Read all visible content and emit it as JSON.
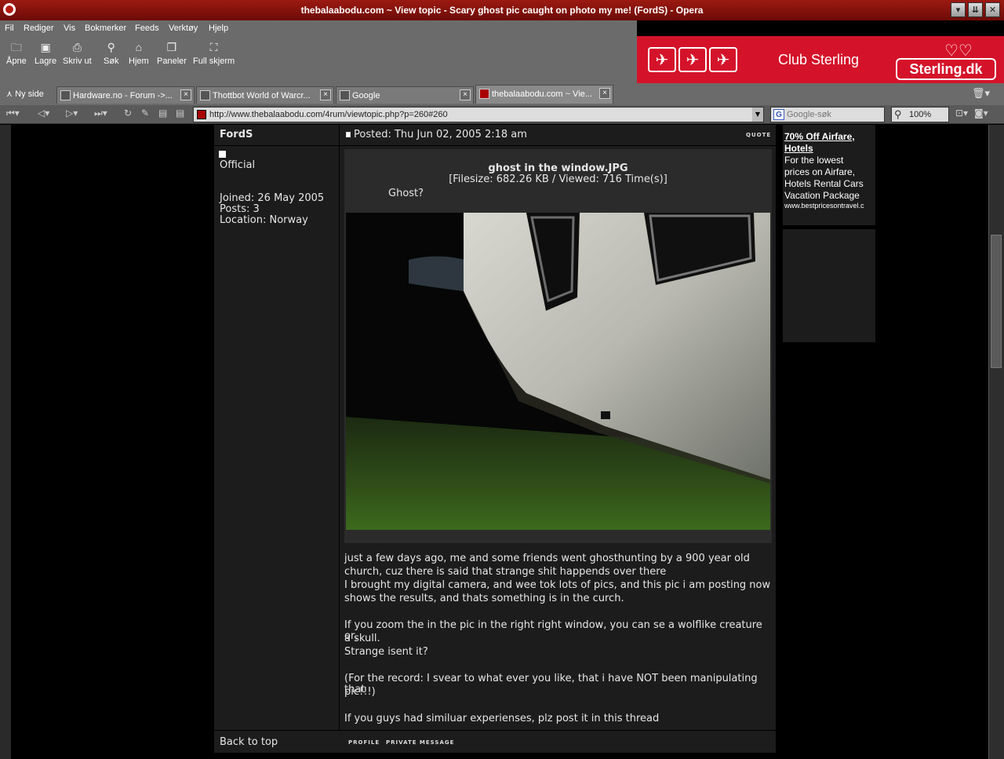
{
  "window": {
    "title": "thebalaabodu.com ~ View topic - Scary ghost pic caught on photo my me! (FordS) - Opera"
  },
  "menu": [
    "Fil",
    "Rediger",
    "Vis",
    "Bokmerker",
    "Feeds",
    "Verktøy",
    "Hjelp"
  ],
  "toolbar": {
    "open": "Åpne",
    "save": "Lagre",
    "print": "Skriv ut",
    "search": "Søk",
    "home": "Hjem",
    "panels": "Paneler",
    "fullscreen": "Full skjerm"
  },
  "banner": {
    "club": "Club Sterling",
    "brand": "Sterling.dk"
  },
  "tabs": {
    "new_tab": "Ny side",
    "items": [
      {
        "label": "Hardware.no - Forum ->..."
      },
      {
        "label": "Thottbot World of Warcr..."
      },
      {
        "label": "Google"
      },
      {
        "label": "thebalaabodu.com ~ Vie..."
      }
    ]
  },
  "address": {
    "url": "http://www.thebalaabodu.com/4rum/viewtopic.php?p=260#260",
    "search_placeholder": "Google-søk",
    "zoom": "100%"
  },
  "post": {
    "author": "FordS",
    "rank": "Official",
    "joined": "Joined: 26 May 2005",
    "posts": "Posts: 3",
    "location": "Location: Norway",
    "posted": "Posted: Thu Jun 02, 2005 2:18 am",
    "quote_btn": "QUOTE",
    "attachment": {
      "filename": "ghost in the window.JPG",
      "info": "[Filesize: 682.26 KB / Viewed: 716 Time(s)]",
      "comment": "Ghost?"
    },
    "body": [
      "just a few days ago, me and some friends went ghosthunting by a 900 year old",
      "church, cuz there is said that strange shit happends over there",
      "I brought my digital camera, and wee tok lots of pics, and this pic i am posting now",
      "shows the results, and thats something is in the curch.",
      "",
      "If you zoom the in the pic in the right right window, you can se a wolflike creature or,",
      "a skull.",
      "Strange isent it?",
      "",
      "(For the record: I svear to what ever you like, that i have NOT been manipulating that",
      "pic!!!)",
      "",
      "If you guys had similuar experienses, plz post it in this thread"
    ],
    "back_to_top": "Back to top",
    "profile_btn": "PROFILE",
    "pm_btn": "PRIVATE MESSAGE"
  },
  "side_ad": {
    "headline_1": "70% Off Airfare,",
    "headline_2": "Hotels",
    "body": [
      "For the lowest",
      "prices on Airfare,",
      "Hotels Rental Cars",
      "Vacation Package"
    ],
    "url": "www.bestpricesontravel.c"
  }
}
